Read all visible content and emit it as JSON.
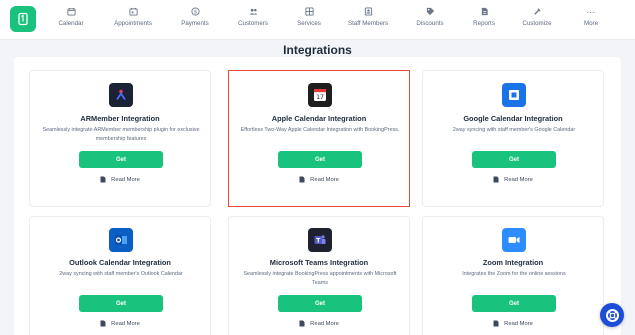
{
  "nav": {
    "items": [
      {
        "label": "Calendar",
        "icon": "calendar-icon"
      },
      {
        "label": "Appointments",
        "icon": "appointment-calendar-icon"
      },
      {
        "label": "Payments",
        "icon": "dollar-icon"
      },
      {
        "label": "Customers",
        "icon": "users-icon"
      },
      {
        "label": "Services",
        "icon": "services-grid-icon"
      },
      {
        "label": "Staff Members",
        "icon": "staff-badge-icon"
      },
      {
        "label": "Discounts",
        "icon": "tag-icon"
      },
      {
        "label": "Reports",
        "icon": "document-icon"
      },
      {
        "label": "Customize",
        "icon": "customize-icon"
      }
    ],
    "more": {
      "dots": "...",
      "label": "More"
    }
  },
  "page": {
    "title": "Integrations"
  },
  "cards": [
    {
      "title": "ARMember Integration",
      "description": "Seamlessly integrate ARMember membership plugin for exclusive membership features",
      "button": "Get",
      "read_more": "Read More",
      "icon": "armember-logo-icon"
    },
    {
      "title": "Apple Calendar Integration",
      "description": "Effortless Two-Way Apple Calendar Integration with BookingPress.",
      "button": "Get",
      "read_more": "Read More",
      "icon": "apple-calendar-icon",
      "highlighted": true
    },
    {
      "title": "Google Calendar Integration",
      "description": "2way syncing with staff member's Google Calendar",
      "button": "Get",
      "read_more": "Read More",
      "icon": "google-calendar-icon"
    },
    {
      "title": "Outlook Calendar Integration",
      "description": "2way syncing with staff member's Outlook Calendar",
      "button": "Get",
      "read_more": "Read More",
      "icon": "outlook-calendar-icon"
    },
    {
      "title": "Microsoft Teams Integration",
      "description": "Seamlessly integrate BookingPress appointments with Microsoft Teams",
      "button": "Get",
      "read_more": "Read More",
      "icon": "microsoft-teams-icon"
    },
    {
      "title": "Zoom Integration",
      "description": "Integrates the Zoom for the online sessions",
      "button": "Get",
      "read_more": "Read More",
      "icon": "zoom-icon"
    }
  ],
  "colors": {
    "accent": "#19c37d",
    "highlight_border": "#ea4b32",
    "help_button": "#1d4ed8"
  },
  "help": {
    "icon": "life-ring-icon"
  }
}
